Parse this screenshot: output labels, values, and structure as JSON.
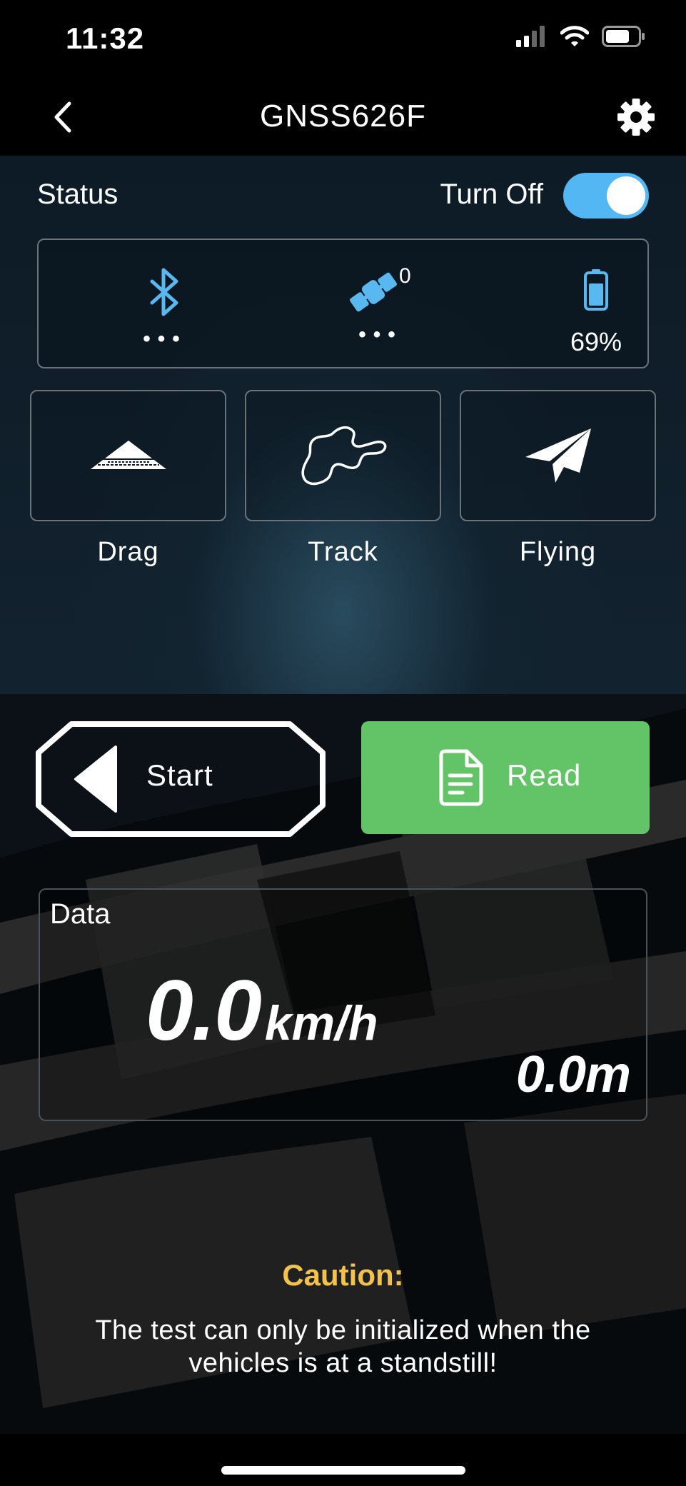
{
  "status_bar": {
    "time": "11:32",
    "icons": [
      "cellular-signal-icon",
      "wifi-icon",
      "battery-icon"
    ]
  },
  "nav": {
    "title": "GNSS626F",
    "back_icon": "chevron-left-icon",
    "settings_icon": "gear-icon"
  },
  "status": {
    "label": "Status",
    "toggle_label": "Turn Off",
    "toggle_on": true,
    "bluetooth": {
      "icon": "bluetooth-icon",
      "value": "•••"
    },
    "satellites": {
      "icon": "satellite-icon",
      "count": "0",
      "value": "•••"
    },
    "battery": {
      "icon": "battery-icon",
      "percent": "69%",
      "level": 0.69
    }
  },
  "modes": [
    {
      "label": "Drag",
      "icon": "drag-strip-icon"
    },
    {
      "label": "Track",
      "icon": "race-track-icon"
    },
    {
      "label": "Flying",
      "icon": "paper-plane-icon"
    }
  ],
  "actions": {
    "start_label": "Start",
    "start_icon": "triangle-left-icon",
    "read_label": "Read",
    "read_icon": "document-icon"
  },
  "data": {
    "label": "Data",
    "speed": "0.0",
    "speed_unit": "km/h",
    "distance": "0.0m"
  },
  "caution": {
    "title": "Caution:",
    "text": "The test can only be initialized when the vehicles is at a standstill!"
  },
  "colors": {
    "accent_blue": "#52b7f2",
    "read_green": "#62c466",
    "caution_yellow": "#f2c14e"
  }
}
